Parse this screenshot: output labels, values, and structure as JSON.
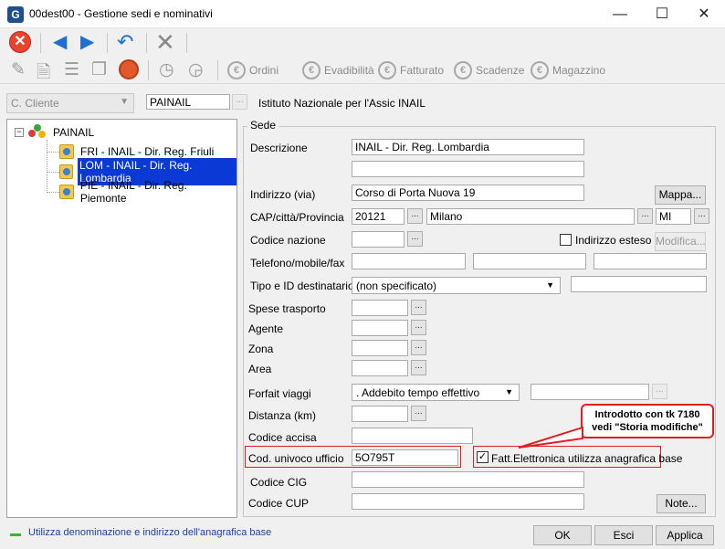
{
  "window": {
    "app_icon": "G",
    "title": "00dest00 - Gestione sedi e nominativi",
    "controls": {
      "minimize": "—",
      "maximize": "☐",
      "close": "✕"
    }
  },
  "toolbar": {
    "items": [
      {
        "label": "Ordini",
        "icon": "orders-icon"
      },
      {
        "label": "Evadibilità",
        "icon": "fulfillable-icon"
      },
      {
        "label": "Fatturato",
        "icon": "invoiced-icon"
      },
      {
        "label": "Scadenze",
        "icon": "deadlines-icon"
      },
      {
        "label": "Magazzino",
        "icon": "warehouse-icon"
      }
    ]
  },
  "customer": {
    "type": "C. Cliente",
    "code": "PAINAIL",
    "name": "Istituto Nazionale per l'Assic INAIL",
    "dots": "..."
  },
  "tree": {
    "root": "PAINAIL",
    "items": [
      {
        "label": "FRI - INAIL - Dir. Reg. Friuli",
        "selected": false
      },
      {
        "label": "LOM - INAIL - Dir. Reg. Lombardia",
        "selected": true
      },
      {
        "label": "PIE - INAIL - Dir. Reg. Piemonte",
        "selected": false
      }
    ]
  },
  "sede": {
    "group_title": "Sede",
    "labels": {
      "descrizione": "Descrizione",
      "indirizzo": "Indirizzo (via)",
      "cap_citta": "CAP/città/Provincia",
      "codice_nazione": "Codice nazione",
      "telefono": "Telefono/mobile/fax",
      "tipo_id": "Tipo e ID destinatario",
      "spese_trasporto": "Spese trasporto",
      "agente": "Agente",
      "zona": "Zona",
      "area": "Area",
      "forfait_viaggi": "Forfait viaggi",
      "distanza": "Distanza (km)",
      "codice_accisa": "Codice accisa",
      "cod_univoco": "Cod. univoco ufficio",
      "codice_cig": "Codice CIG",
      "codice_cup": "Codice CUP"
    },
    "values": {
      "descrizione1": "INAIL - Dir. Reg. Lombardia",
      "descrizione2": "",
      "indirizzo": "Corso di Porta Nuova 19",
      "cap": "20121",
      "citta": "Milano",
      "provincia": "MI",
      "tipo_destinatario": "(non specificato)",
      "forfait_viaggi": ". Addebito tempo effettivo",
      "cod_univoco": "5O795T"
    },
    "buttons": {
      "mappa": "Mappa...",
      "modifica": "Modifica...",
      "note": "Note...",
      "dots": "..."
    },
    "checkboxes": {
      "indirizzo_esteso": {
        "label": "Indirizzo esteso",
        "checked": false
      },
      "fatt_elettronica": {
        "label": "Fatt.Elettronica utilizza anagrafica base",
        "checked": true
      }
    },
    "callout": {
      "line1": "Introdotto con tk 7180",
      "line2": "vedi \"Storia modifiche\""
    }
  },
  "status": {
    "text": "Utilizza denominazione e indirizzo dell'anagrafica base"
  },
  "footer": {
    "ok": "OK",
    "esci": "Esci",
    "applica": "Applica"
  },
  "colors": {
    "selection": "#0a39d6",
    "callout_border": "#e02020",
    "accent_blue": "#1f6fd0",
    "status_green": "#2db82d"
  }
}
